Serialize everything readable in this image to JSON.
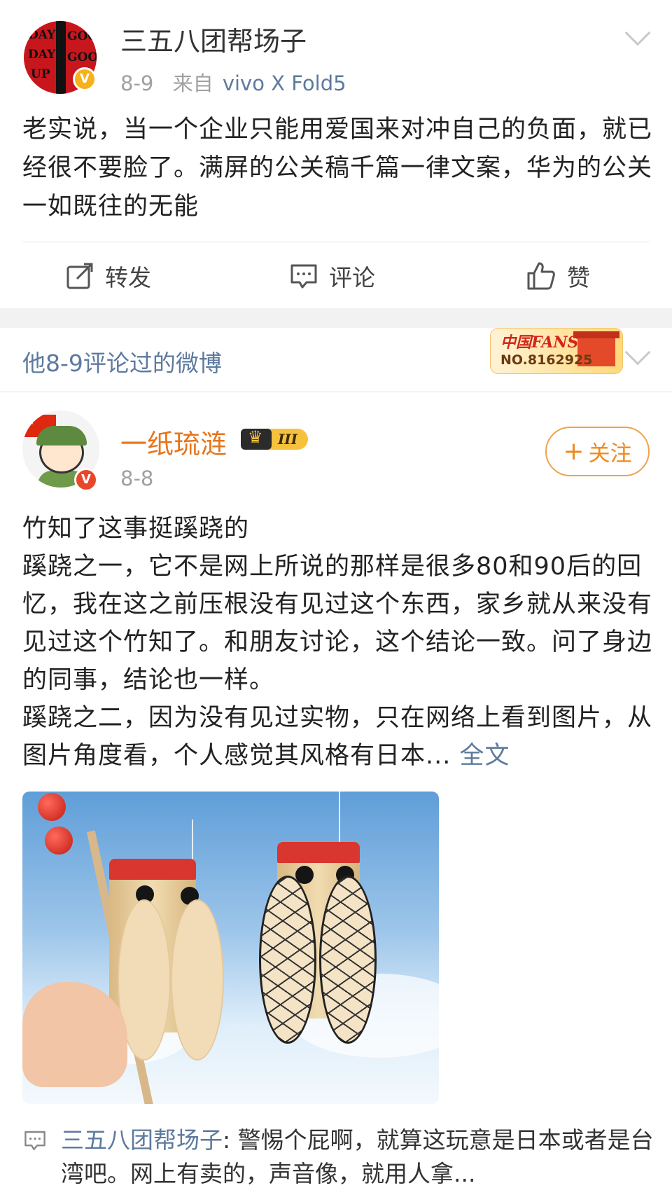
{
  "post1": {
    "username": "三五八团帮场子",
    "date": "8-9",
    "source_prefix": "来自",
    "device": "vivo X Fold5",
    "text": "老实说，当一个企业只能用爱国来对冲自己的负面，就已经很不要脸了。满屏的公关稿千篇一律文案，华为的公关一如既往的无能",
    "actions": {
      "repost": "转发",
      "comment": "评论",
      "like": "赞"
    },
    "avatar_text": [
      "DAY",
      "GOOD",
      "DAY",
      "GOOD",
      "UP"
    ],
    "badge": "V"
  },
  "commented": {
    "title": "他8-9评论过的微博",
    "fans_badge_logo": "中国FANS",
    "fans_badge_no": "NO.8162925"
  },
  "post2": {
    "username": "一纸琉涟",
    "member_level": "III",
    "date": "8-8",
    "follow_label": "关注",
    "follow_plus": "+",
    "badge": "V",
    "lines": [
      "竹知了这事挺蹊跷的",
      "蹊跷之一，它不是网上所说的那样是很多80和90后的回忆，我在这之前压根没有见过这个东西，家乡就从来没有见过这个竹知了。和朋友讨论，这个结论一致。问了身边的同事，结论也一样。",
      "蹊跷之二，因为没有见过实物，只在网络上看到图片，从图片角度看，个人感觉其风格有日本..."
    ],
    "more": "全文"
  },
  "comment": {
    "author": "三五八团帮场子",
    "separator": ": ",
    "text": "警惕个屁啊，就算这玩意是日本或者是台湾吧。网上有卖的，声音像，就用人拿..."
  },
  "colors": {
    "link": "#5d7a9e",
    "orange_name": "#e8741a",
    "follow": "#f0891c",
    "vip_badge": "#f6b21b"
  }
}
